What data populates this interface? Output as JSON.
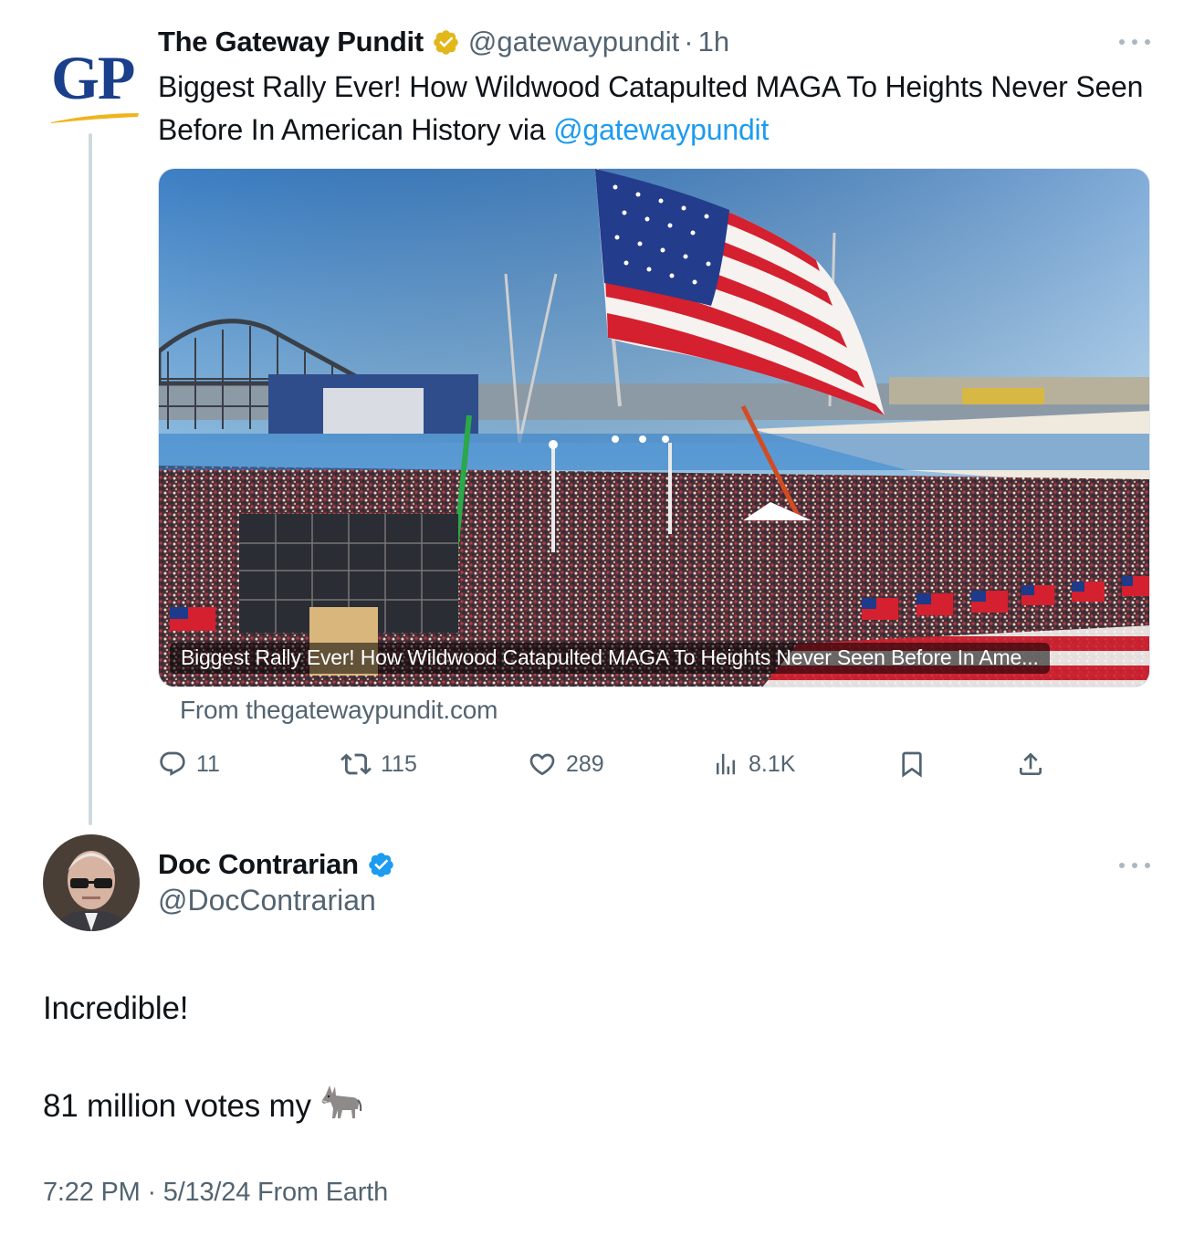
{
  "quoted_tweet": {
    "author_name": "The Gateway Pundit",
    "avatar_text": "GP",
    "badge": "gold-verified-icon",
    "handle": "@gatewaypundit",
    "separator": "·",
    "time": "1h",
    "text": "Biggest Rally Ever! How Wildwood Catapulted MAGA To Heights Never Seen Before In American History via ",
    "mention": "@gatewaypundit",
    "card": {
      "caption": "Biggest Rally Ever! How Wildwood Catapulted MAGA To Heights Never Seen Before In Ame...",
      "source": "From thegatewaypundit.com"
    },
    "actions": {
      "replies": "11",
      "reposts": "115",
      "likes": "289",
      "views": "8.1K"
    }
  },
  "tweet": {
    "author_name": "Doc Contrarian",
    "badge": "blue-verified-icon",
    "handle": "@DocContrarian",
    "line1": "Incredible!",
    "line2": "81 million votes my",
    "emoji": "donkey-emoji",
    "meta": "7:22 PM · 5/13/24 From Earth"
  },
  "colors": {
    "text": "#0f1419",
    "secondary": "#536471",
    "link": "#1d9bf0",
    "thread_line": "#cfd9de",
    "gold_badge": "#e2b719",
    "blue_badge": "#1d9bf0",
    "gp_blue": "#1a3f8b",
    "gp_gold": "#f0b41c"
  }
}
